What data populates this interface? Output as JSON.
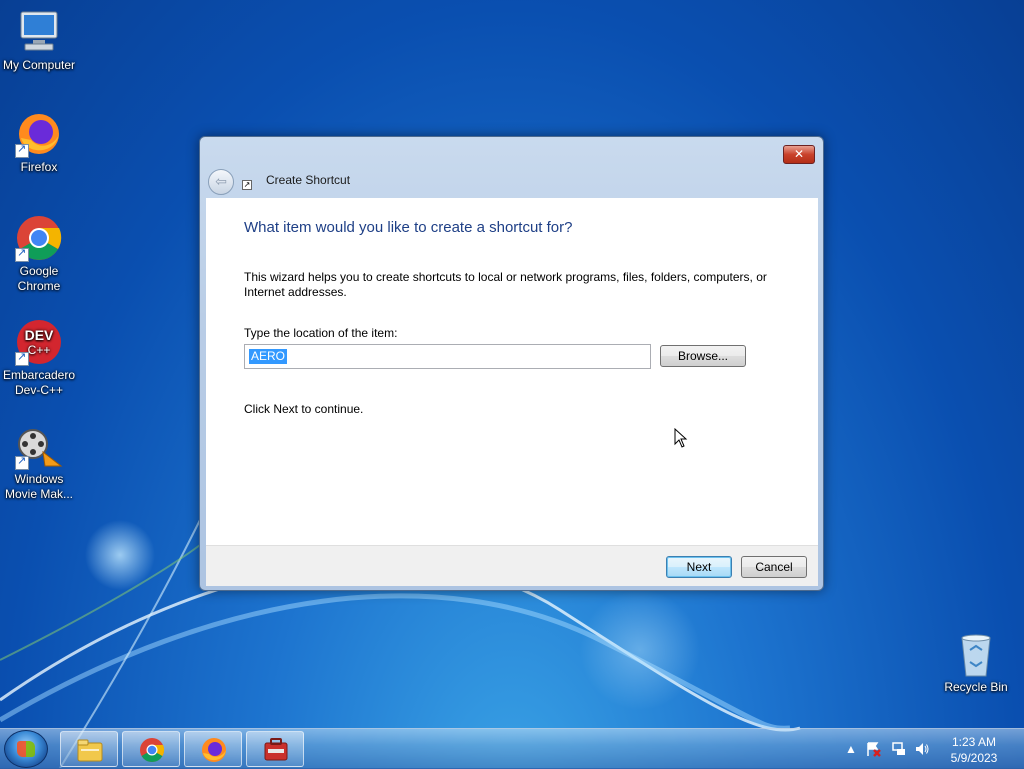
{
  "desktop": {
    "icons": [
      {
        "label": "My Computer",
        "icon": "computer-icon"
      },
      {
        "label": "Firefox",
        "icon": "firefox-icon"
      },
      {
        "label": "Google Chrome",
        "icon": "chrome-icon"
      },
      {
        "label": "Embarcadero Dev-C++",
        "icon": "devcpp-icon"
      },
      {
        "label": "Windows Movie Mak...",
        "icon": "movie-maker-icon"
      },
      {
        "label": "Recycle Bin",
        "icon": "recycle-bin-icon"
      }
    ]
  },
  "dialog": {
    "title": "Create Shortcut",
    "close_label": "✕",
    "heading": "What item would you like to create a shortcut for?",
    "description": "This wizard helps you to create shortcuts to local or network programs, files, folders, computers, or Internet addresses.",
    "location_label": "Type the location of the item:",
    "location_value": "AERO",
    "browse_label": "Browse...",
    "continue_text": "Click Next to continue.",
    "next_label": "Next",
    "cancel_label": "Cancel"
  },
  "taskbar": {
    "pinned": [
      "windows-explorer-icon",
      "chrome-icon",
      "firefox-icon",
      "control-panel-icon"
    ],
    "clock_time": "1:23 AM",
    "clock_date": "5/9/2023",
    "tray": [
      "show-hidden-icons",
      "action-center-icon",
      "network-icon",
      "volume-icon"
    ]
  },
  "colors": {
    "heading": "#1e3f86",
    "desktop": "#1d74cf",
    "selection": "#3399ff"
  }
}
